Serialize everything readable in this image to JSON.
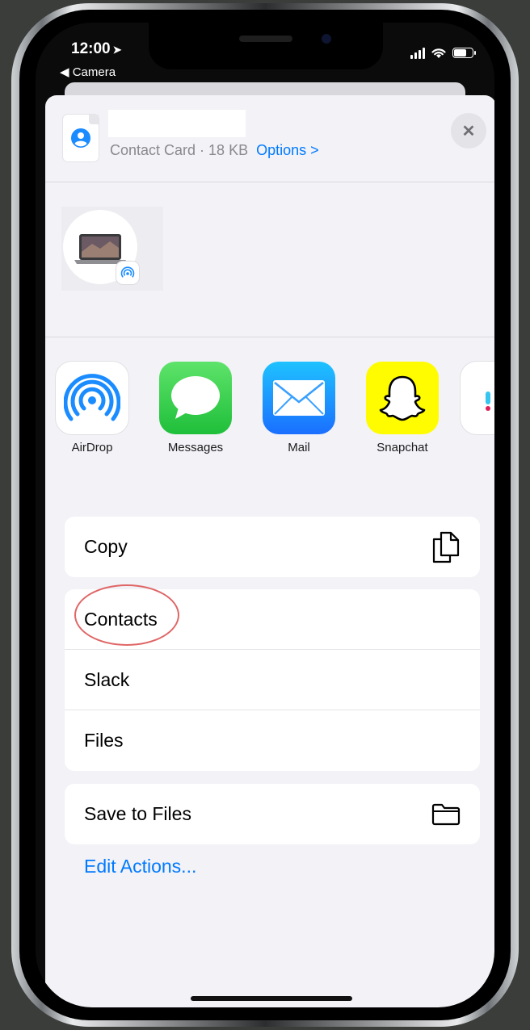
{
  "status_bar": {
    "time": "12:00",
    "location_arrow": "➤",
    "back_label": "◀ Camera"
  },
  "share_sheet": {
    "file_meta": "Contact Card · 18 KB",
    "options_link": "Options >",
    "close_glyph": "✕"
  },
  "apps": [
    {
      "label": "AirDrop",
      "icon": "airdrop-icon"
    },
    {
      "label": "Messages",
      "icon": "messages-icon"
    },
    {
      "label": "Mail",
      "icon": "mail-icon"
    },
    {
      "label": "Snapchat",
      "icon": "snapchat-icon"
    }
  ],
  "actions": {
    "copy": "Copy",
    "contacts": "Contacts",
    "slack": "Slack",
    "files": "Files",
    "save_to_files": "Save to Files",
    "edit_actions": "Edit Actions..."
  },
  "colors": {
    "accent": "#007aff",
    "messages_green": "#34c759",
    "mail_blue": "#1a8cff",
    "snapchat_yellow": "#fffc00",
    "highlight_ring": "#e06666"
  }
}
